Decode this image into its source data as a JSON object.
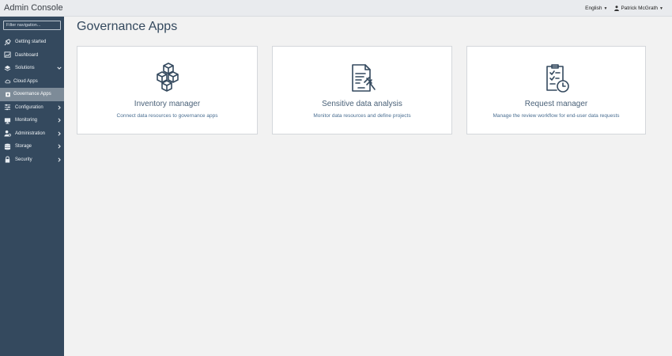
{
  "app": {
    "title": "Admin Console"
  },
  "header": {
    "language": "English",
    "user": "Patrick McGrath"
  },
  "sidebar": {
    "filter_placeholder": "Filter navigation...",
    "items": [
      {
        "label": "Getting started",
        "icon": "rocket-icon"
      },
      {
        "label": "Dashboard",
        "icon": "dashboard-icon"
      },
      {
        "label": "Solutions",
        "icon": "layers-icon",
        "expanded": true
      },
      {
        "label": "Cloud Apps",
        "icon": "cloud-icon"
      },
      {
        "label": "Governance Apps",
        "icon": "governance-icon",
        "active": true
      },
      {
        "label": "Configuration",
        "icon": "sliders-icon"
      },
      {
        "label": "Monitoring",
        "icon": "monitor-icon"
      },
      {
        "label": "Administration",
        "icon": "user-gear-icon"
      },
      {
        "label": "Storage",
        "icon": "database-icon"
      },
      {
        "label": "Security",
        "icon": "lock-icon"
      }
    ]
  },
  "main": {
    "title": "Governance Apps",
    "cards": [
      {
        "title": "Inventory manager",
        "description": "Connect data resources to governance apps",
        "icon": "cubes-icon"
      },
      {
        "title": "Sensitive data analysis",
        "description": "Monitor data resources and define projects",
        "icon": "document-gavel-icon"
      },
      {
        "title": "Request manager",
        "description": "Manage the review workflow for end-user data requests",
        "icon": "clipboard-clock-icon"
      }
    ]
  },
  "colors": {
    "sidebar_bg": "#34495e",
    "active_item": "#7d8b98",
    "accent_text": "#4a6e91",
    "page_bg": "#f2f2f2"
  }
}
